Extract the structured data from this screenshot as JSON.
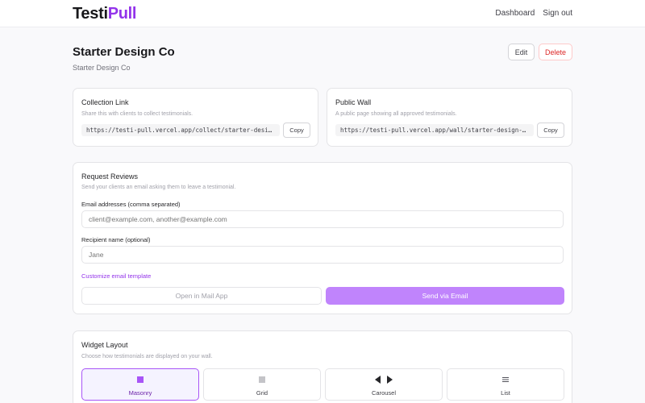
{
  "app": {
    "logo_part1": "Testi",
    "logo_part2": "Pull"
  },
  "nav": {
    "dashboard": "Dashboard",
    "signout": "Sign out"
  },
  "header": {
    "title": "Starter Design Co",
    "subtitle": "Starter Design Co",
    "edit_label": "Edit",
    "delete_label": "Delete"
  },
  "collection_link": {
    "title": "Collection Link",
    "description": "Share this with clients to collect testimonials.",
    "url": "https://testi-pull.vercel.app/collect/starter-design-co",
    "copy_label": "Copy"
  },
  "public_wall": {
    "title": "Public Wall",
    "description": "A public page showing all approved testimonials.",
    "url": "https://testi-pull.vercel.app/wall/starter-design-co",
    "copy_label": "Copy"
  },
  "request_reviews": {
    "title": "Request Reviews",
    "description": "Send your clients an email asking them to leave a testimonial.",
    "email_label": "Email addresses (comma separated)",
    "email_placeholder": "client@example.com, another@example.com",
    "email_value": "",
    "name_label": "Recipient name (optional)",
    "name_placeholder": "Jane",
    "name_value": "",
    "customize_label": "Customize email template",
    "open_mail_label": "Open in Mail App",
    "send_label": "Send via Email"
  },
  "widget_layout": {
    "title": "Widget Layout",
    "description": "Choose how testimonials are displayed on your wall.",
    "options": [
      {
        "label": "Masonry",
        "icon": "masonry-icon",
        "selected": true
      },
      {
        "label": "Grid",
        "icon": "grid-icon",
        "selected": false
      },
      {
        "label": "Carousel",
        "icon": "carousel-arrows-icon",
        "selected": false
      },
      {
        "label": "List",
        "icon": "list-icon",
        "selected": false
      }
    ]
  },
  "colors": {
    "accent": "#9333ea",
    "send_button": "#c084fc",
    "delete": "#dc2626",
    "selected_bg": "#f5f3ff"
  }
}
